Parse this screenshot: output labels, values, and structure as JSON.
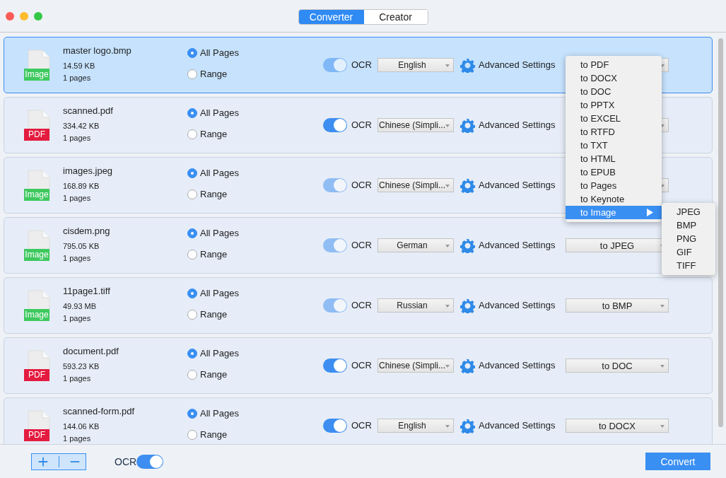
{
  "tabs": [
    {
      "label": "Converter",
      "selected": true
    },
    {
      "label": "Creator",
      "selected": false
    }
  ],
  "files": [
    {
      "name": "master logo.bmp",
      "size": "14.59 KB",
      "pages": "1 pages",
      "kind": "image",
      "badge": "Image",
      "selected": true,
      "range": [
        {
          "label": "All Pages",
          "selected": true
        },
        {
          "label": "Range",
          "selected": false
        }
      ],
      "ocr": {
        "label": "OCR",
        "on": true,
        "disabled": true
      },
      "language": "English",
      "settings": "Advanced Settings"
    },
    {
      "name": "scanned.pdf",
      "size": "334.42 KB",
      "pages": "1 pages",
      "kind": "pdf",
      "badge": "PDF",
      "selected": false,
      "range": [
        {
          "label": "All Pages",
          "selected": true
        },
        {
          "label": "Range",
          "selected": false
        }
      ],
      "ocr": {
        "label": "OCR",
        "on": true,
        "disabled": false
      },
      "language": "Chinese (Simpli...",
      "settings": "Advanced Settings"
    },
    {
      "name": "images.jpeg",
      "size": "168.89 KB",
      "pages": "1 pages",
      "kind": "image",
      "badge": "Image",
      "selected": false,
      "range": [
        {
          "label": "All Pages",
          "selected": true
        },
        {
          "label": "Range",
          "selected": false
        }
      ],
      "ocr": {
        "label": "OCR",
        "on": true,
        "disabled": true
      },
      "language": "Chinese (Simpli...",
      "settings": "Advanced Settings"
    },
    {
      "name": "cisdem.png",
      "size": "795.05 KB",
      "pages": "1 pages",
      "kind": "image",
      "badge": "Image",
      "selected": false,
      "range": [
        {
          "label": "All Pages",
          "selected": true
        },
        {
          "label": "Range",
          "selected": false
        }
      ],
      "ocr": {
        "label": "OCR",
        "on": true,
        "disabled": true
      },
      "language": "German",
      "settings": "Advanced Settings",
      "format": "to JPEG"
    },
    {
      "name": "11page1.tiff",
      "size": "49.93 MB",
      "pages": "1 pages",
      "kind": "image",
      "badge": "Image",
      "selected": false,
      "range": [
        {
          "label": "All Pages",
          "selected": true
        },
        {
          "label": "Range",
          "selected": false
        }
      ],
      "ocr": {
        "label": "OCR",
        "on": true,
        "disabled": true
      },
      "language": "Russian",
      "settings": "Advanced Settings",
      "format": "to BMP"
    },
    {
      "name": "document.pdf",
      "size": "593.23 KB",
      "pages": "1 pages",
      "kind": "pdf",
      "badge": "PDF",
      "selected": false,
      "range": [
        {
          "label": "All Pages",
          "selected": true
        },
        {
          "label": "Range",
          "selected": false
        }
      ],
      "ocr": {
        "label": "OCR",
        "on": true,
        "disabled": false
      },
      "language": "Chinese (Simpli...",
      "settings": "Advanced Settings",
      "format": "to DOC"
    },
    {
      "name": "scanned-form.pdf",
      "size": "144.06 KB",
      "pages": "1 pages",
      "kind": "pdf",
      "badge": "PDF",
      "selected": false,
      "range": [
        {
          "label": "All Pages",
          "selected": true
        },
        {
          "label": "Range",
          "selected": false
        }
      ],
      "ocr": {
        "label": "OCR",
        "on": true,
        "disabled": false
      },
      "language": "English",
      "settings": "Advanced Settings",
      "format": "to DOCX"
    }
  ],
  "format_menu": {
    "items": [
      {
        "label": "to PDF",
        "selected": false,
        "kind": "item"
      },
      {
        "label": "to DOCX",
        "selected": false,
        "kind": "item"
      },
      {
        "label": "to DOC",
        "selected": false,
        "kind": "item"
      },
      {
        "label": "to PPTX",
        "selected": false,
        "kind": "item"
      },
      {
        "label": "to EXCEL",
        "selected": false,
        "kind": "item"
      },
      {
        "label": "to RTFD",
        "selected": false,
        "kind": "item"
      },
      {
        "label": "to TXT",
        "selected": false,
        "kind": "item"
      },
      {
        "label": "to HTML",
        "selected": false,
        "kind": "item"
      },
      {
        "label": "to EPUB",
        "selected": false,
        "kind": "item"
      },
      {
        "label": "to Pages",
        "selected": false,
        "kind": "item"
      },
      {
        "label": "to Keynote",
        "selected": false,
        "kind": "item"
      },
      {
        "label": "to Image",
        "selected": true,
        "kind": "submenu"
      }
    ],
    "submenu": [
      "JPEG",
      "BMP",
      "PNG",
      "GIF",
      "TIFF"
    ]
  },
  "bottom_bar": {
    "ocr": {
      "label": "OCR",
      "on": true
    },
    "convert": "Convert"
  }
}
